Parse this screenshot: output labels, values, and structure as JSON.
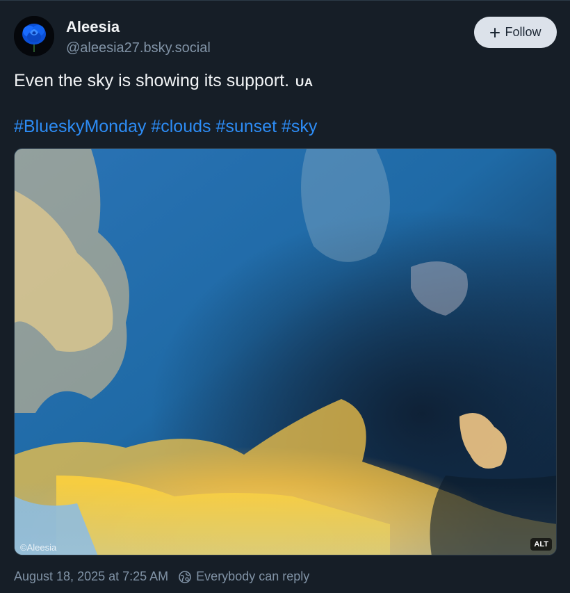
{
  "author": {
    "display_name": "Aleesia",
    "handle": "@aleesia27.bsky.social",
    "avatar_icon": "blue-rose-avatar"
  },
  "follow_button": {
    "label": "Follow",
    "icon": "plus-icon"
  },
  "post": {
    "text": "Even the sky is showing its support.",
    "flag": "UA",
    "hashtags": [
      "#BlueskyMonday",
      "#clouds",
      "#sunset",
      "#sky"
    ]
  },
  "media": {
    "watermark": "©Aleesia",
    "alt_label": "ALT"
  },
  "footer": {
    "timestamp": "August 18, 2025 at 7:25 AM",
    "reply_setting": "Everybody can reply",
    "reply_icon": "globe-reply-icon"
  },
  "colors": {
    "background": "#161e27",
    "accent": "#2d8cf5",
    "muted_text": "#8193a6",
    "sky_blue": "#1f6fa8",
    "cloud_gold": "#f4c542"
  }
}
